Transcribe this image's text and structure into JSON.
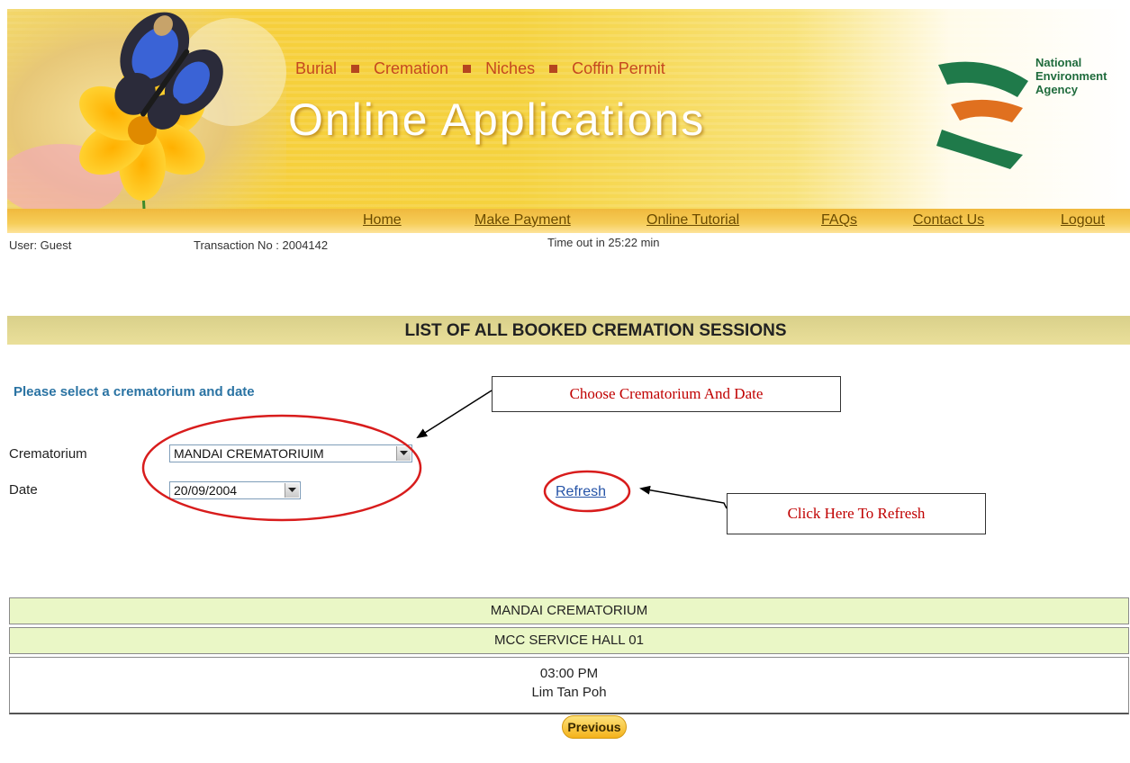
{
  "banner": {
    "services": [
      "Burial",
      "Cremation",
      "Niches",
      "Coffin Permit"
    ],
    "title": "Online Applications",
    "agency_lines": [
      "National",
      "Environment",
      "Agency"
    ]
  },
  "nav": {
    "home": "Home",
    "make_payment": "Make Payment",
    "online_tutorial": "Online Tutorial",
    "faqs": "FAQs",
    "contact_us": "Contact Us",
    "logout": "Logout"
  },
  "status": {
    "user": "User: Guest",
    "transaction": "Transaction No : 2004142",
    "timeout": "Time out in 25:22 min"
  },
  "page": {
    "title": "LIST OF ALL BOOKED CREMATION SESSIONS",
    "instruction": "Please select a crematorium and date"
  },
  "form": {
    "crematorium_label": "Crematorium",
    "crematorium_value": "MANDAI CREMATORIUIM",
    "date_label": "Date",
    "date_value": "20/09/2004",
    "refresh_label": "Refresh"
  },
  "callouts": {
    "choose": "Choose Crematorium And Date",
    "refresh": "Click Here To Refresh"
  },
  "results": {
    "crematorium": "MANDAI CREMATORIUM",
    "hall": "MCC SERVICE HALL 01",
    "time": "03:00 PM",
    "name": "Lim Tan Poh"
  },
  "buttons": {
    "previous": "Previous"
  },
  "colors": {
    "banner_yellow": "#f5d23e",
    "nav_orange": "#f0b93d",
    "title_bar": "#e2d892",
    "table_head_green": "#eaf7c6",
    "instruction_blue": "#2a73a3",
    "callout_red": "#c00000",
    "annotation_ellipse": "#d81c1c"
  }
}
